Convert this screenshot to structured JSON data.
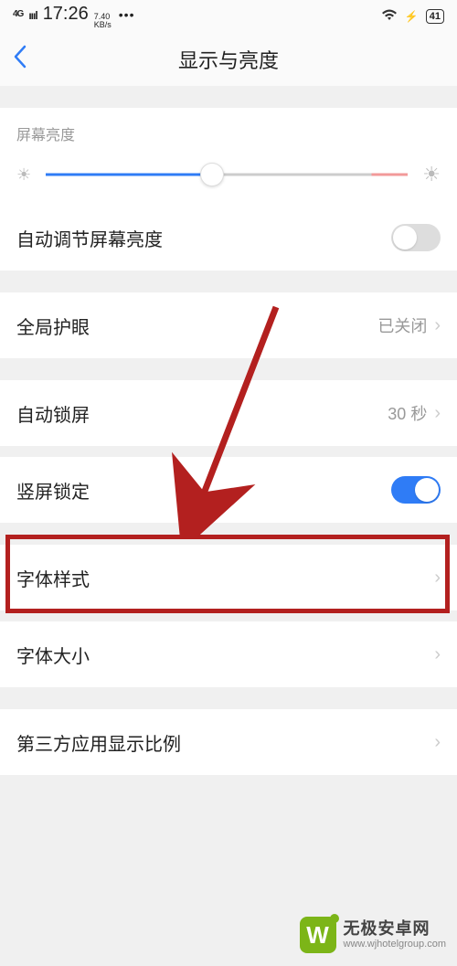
{
  "status": {
    "network": "4G HD",
    "signal_bars": "ıııl",
    "time": "17:26",
    "speed_value": "7.40",
    "speed_unit": "KB/s",
    "battery_pct": "41"
  },
  "header": {
    "title": "显示与亮度"
  },
  "brightness": {
    "label": "屏幕亮度",
    "value_pct": 46
  },
  "rows": {
    "auto_brightness": {
      "label": "自动调节屏幕亮度",
      "toggle_on": false
    },
    "eye_care": {
      "label": "全局护眼",
      "value": "已关闭"
    },
    "auto_lock": {
      "label": "自动锁屏",
      "value": "30 秒"
    },
    "portrait_lock": {
      "label": "竖屏锁定",
      "toggle_on": true
    },
    "font_style": {
      "label": "字体样式"
    },
    "font_size": {
      "label": "字体大小"
    },
    "third_party": {
      "label": "第三方应用显示比例"
    }
  },
  "annotation": {
    "highlighted_row": "font_style"
  },
  "watermark": {
    "logo_text": "W",
    "cn": "无极安卓网",
    "en": "www.wjhotelgroup.com"
  }
}
